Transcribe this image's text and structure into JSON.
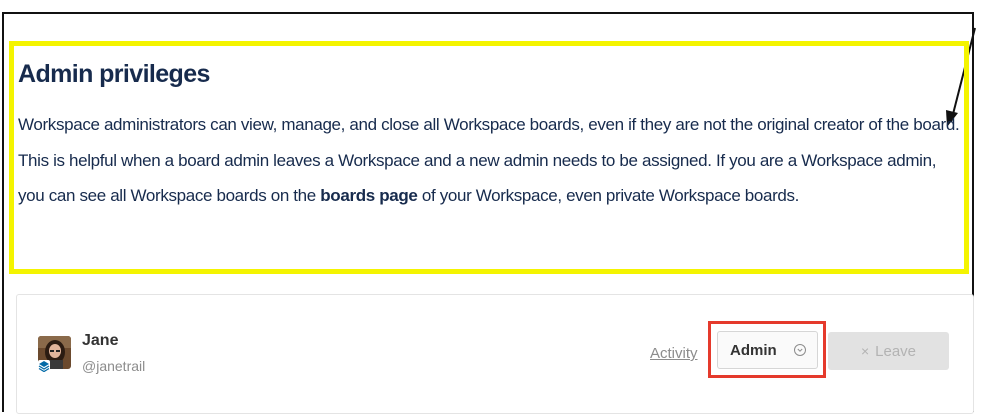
{
  "section": {
    "title": "Admin privileges",
    "paragraph": {
      "part1": "Workspace administrators can view, manage, and close all Workspace boards, even if they are not the original creator of the board. This is helpful when a board admin leaves a Workspace and a new admin needs to be assigned. If you are a Workspace admin, you can see all Workspace boards on the ",
      "bold": "boards page",
      "part2": " of your Workspace, even private Workspace boards."
    }
  },
  "member": {
    "name": "Jane",
    "handle": "@janetrail",
    "activity_label": "Activity",
    "role": "Admin",
    "leave_icon": "×",
    "leave_label": "Leave"
  },
  "colors": {
    "highlight": "#f4f400",
    "callout_red": "#e53a2c",
    "text": "#172b4d"
  },
  "icons": [
    "arrow-pointer-icon",
    "avatar-photo",
    "workspace-badge-icon",
    "chevron-down-circle-icon",
    "close-icon"
  ]
}
